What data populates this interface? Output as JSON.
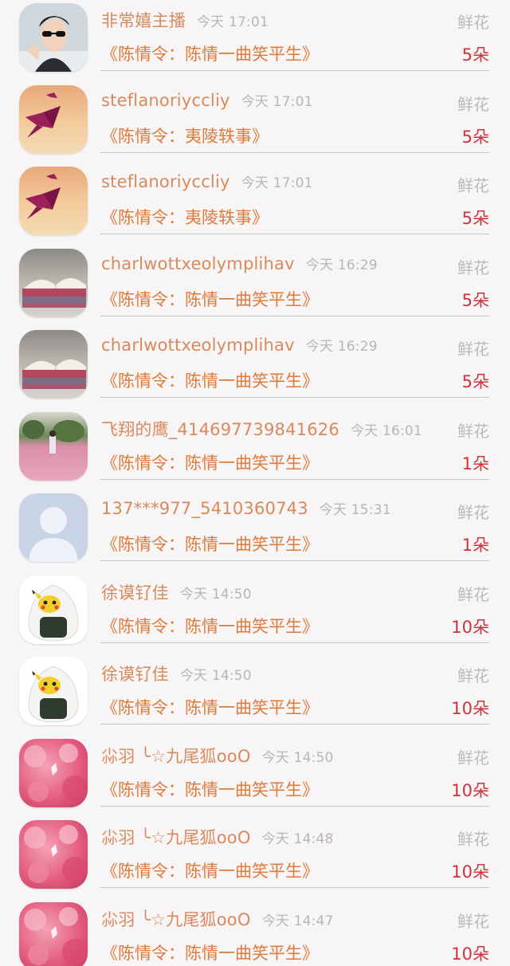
{
  "gift_list": [
    {
      "user": "非常嬉主播",
      "time": "今天 17:01",
      "label": "鲜花",
      "book": "《陈情令：陈情一曲笑平生》",
      "count": "5朵",
      "avatar": "man-sunglasses"
    },
    {
      "user": "steflanoriyccliy",
      "time": "今天 17:01",
      "label": "鲜花",
      "book": "《陈情令：夷陵轶事》",
      "count": "5朵",
      "avatar": "crane"
    },
    {
      "user": "steflanoriyccliy",
      "time": "今天 17:01",
      "label": "鲜花",
      "book": "《陈情令：夷陵轶事》",
      "count": "5朵",
      "avatar": "crane"
    },
    {
      "user": "charlwottxeolymplihav",
      "time": "今天 16:29",
      "label": "鲜花",
      "book": "《陈情令：陈情一曲笑平生》",
      "count": "5朵",
      "avatar": "books"
    },
    {
      "user": "charlwottxeolymplihav",
      "time": "今天 16:29",
      "label": "鲜花",
      "book": "《陈情令：陈情一曲笑平生》",
      "count": "5朵",
      "avatar": "books"
    },
    {
      "user": "飞翔的鹰_414697739841626",
      "time": "今天 16:01",
      "label": "鲜花",
      "book": "《陈情令：陈情一曲笑平生》",
      "count": "1朵",
      "avatar": "pink-field"
    },
    {
      "user": "137***977_5410360743",
      "time": "今天 15:31",
      "label": "鲜花",
      "book": "《陈情令：陈情一曲笑平生》",
      "count": "1朵",
      "avatar": "default-person"
    },
    {
      "user": "徐谟钌佳",
      "time": "今天 14:50",
      "label": "鲜花",
      "book": "《陈情令：陈情一曲笑平生》",
      "count": "10朵",
      "avatar": "pikachu-onigiri"
    },
    {
      "user": "徐谟钌佳",
      "time": "今天 14:50",
      "label": "鲜花",
      "book": "《陈情令：陈情一曲笑平生》",
      "count": "10朵",
      "avatar": "pikachu-onigiri"
    },
    {
      "user": "尛羽 ╰☆九尾狐ooO",
      "time": "今天 14:50",
      "label": "鲜花",
      "book": "《陈情令：陈情一曲笑平生》",
      "count": "10朵",
      "avatar": "pink-blossom"
    },
    {
      "user": "尛羽 ╰☆九尾狐ooO",
      "time": "今天 14:48",
      "label": "鲜花",
      "book": "《陈情令：陈情一曲笑平生》",
      "count": "10朵",
      "avatar": "pink-blossom"
    },
    {
      "user": "尛羽 ╰☆九尾狐ooO",
      "time": "今天 14:47",
      "label": "鲜花",
      "book": "《陈情令：陈情一曲笑平生》",
      "count": "10朵",
      "avatar": "pink-blossom"
    }
  ]
}
